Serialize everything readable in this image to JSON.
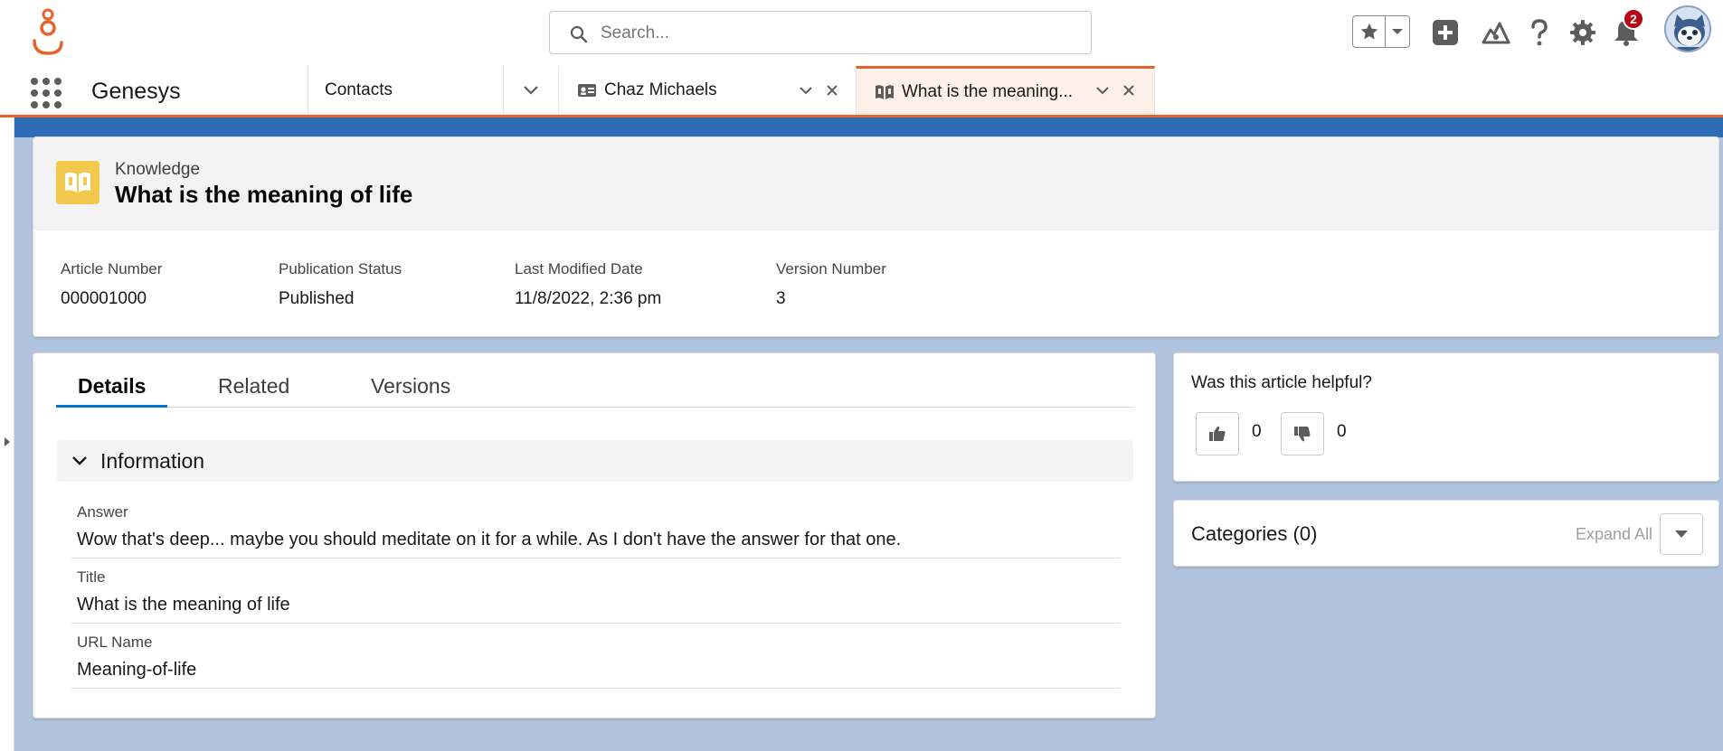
{
  "header": {
    "search_placeholder": "Search...",
    "notification_count": "2",
    "icons": [
      "genesys-logo-icon",
      "search-icon",
      "favorites-star-icon",
      "chevron-down-icon",
      "global-actions-plus-icon",
      "trailhead-icon",
      "help-icon",
      "setup-gear-icon",
      "bell-icon",
      "avatar"
    ]
  },
  "nav": {
    "app_name": "Genesys",
    "tabs": [
      {
        "label": "Contacts"
      },
      {
        "label": "Chaz Michaels"
      },
      {
        "label": "What is the meaning..."
      }
    ]
  },
  "record": {
    "object_type": "Knowledge",
    "title": "What is the meaning of life",
    "highlights": [
      {
        "label": "Article Number",
        "value": "000001000"
      },
      {
        "label": "Publication Status",
        "value": "Published"
      },
      {
        "label": "Last Modified Date",
        "value": "11/8/2022, 2:36 pm"
      },
      {
        "label": "Version Number",
        "value": "3"
      }
    ]
  },
  "detail_tabs": [
    "Details",
    "Related",
    "Versions"
  ],
  "active_tab": "Details",
  "section": {
    "title": "Information",
    "fields": [
      {
        "label": "Answer",
        "value": "Wow that's deep... maybe you should meditate on it for a while. As I don't have the answer for that one."
      },
      {
        "label": "Title",
        "value": "What is the meaning of life"
      },
      {
        "label": "URL Name",
        "value": "Meaning-of-life"
      }
    ]
  },
  "helpful": {
    "question": "Was this article helpful?",
    "up_count": "0",
    "down_count": "0"
  },
  "categories": {
    "title": "Categories (0)",
    "expand_label": "Expand All"
  },
  "colors": {
    "brand_orange": "#e8632b",
    "knowledge_icon": "#f2c94c",
    "active_tab_underline": "#0176d3",
    "badge": "#ba0517",
    "page_background": "#b0c4df"
  }
}
